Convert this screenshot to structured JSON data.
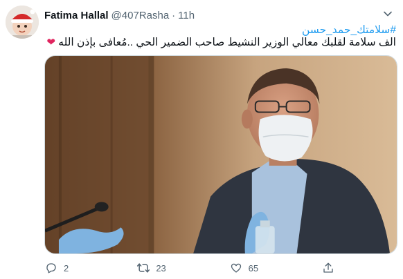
{
  "tweet": {
    "author": {
      "display_name": "Fatima Hallal",
      "handle": "@407Rasha",
      "separator": "·",
      "time": "11h"
    },
    "hashtag": "#سلامتك_حمد_حسن",
    "text": "الف سلامة لقلبك معالي الوزير النشيط صاحب الضمير الحي ..مُعافى بإذن الله",
    "heart_emoji": "❤",
    "stats": {
      "replies": "2",
      "retweets": "23",
      "likes": "65"
    }
  },
  "colors": {
    "link": "#1d9bf0",
    "secondary_text": "#536471",
    "border": "#cfd9de",
    "heart": "#e0245e"
  },
  "icons": {
    "menu": "chevron-down-icon",
    "reply": "reply-icon",
    "retweet": "retweet-icon",
    "like": "like-icon",
    "share": "share-icon"
  }
}
